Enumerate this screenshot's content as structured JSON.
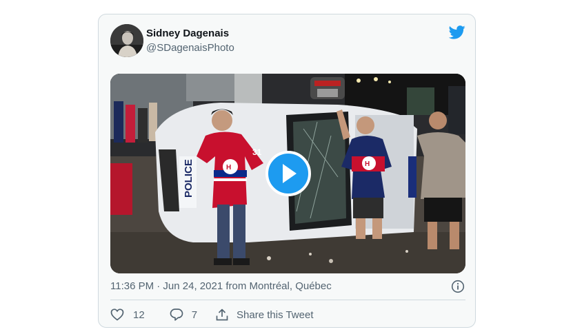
{
  "tweet": {
    "author_name": "Sidney Dagenais",
    "author_handle": "@SDagenaisPhoto",
    "timestamp": "11:36 PM · Jun 24, 2021 from Montréal, Québec",
    "likes": "12",
    "replies": "7",
    "share_label": "Share this Tweet"
  },
  "media": {
    "car_text": "POLICE",
    "jersey_number": "31"
  },
  "icons": {
    "brand": "twitter-bird-icon",
    "play": "play-icon",
    "info": "info-icon",
    "like": "heart-icon",
    "reply": "reply-bubble-icon",
    "share": "share-icon"
  },
  "colors": {
    "brand_blue": "#1d9bf0",
    "text_secondary": "#536471",
    "card_border": "#cfd9de",
    "jersey_red": "#c8102e"
  }
}
